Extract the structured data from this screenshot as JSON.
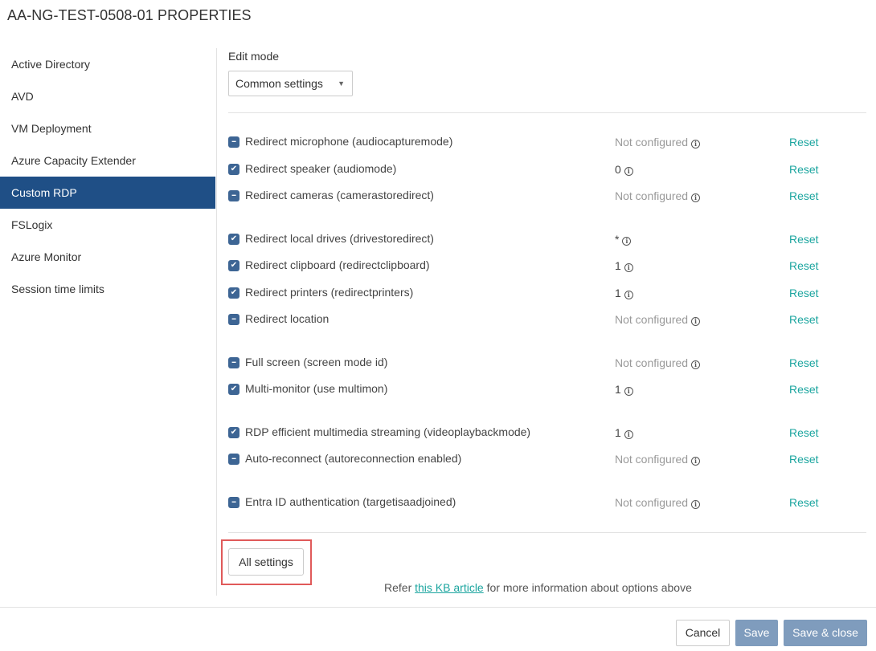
{
  "window": {
    "title": "AA-NG-TEST-0508-01 PROPERTIES"
  },
  "sidebar": {
    "items": [
      {
        "label": "Active Directory",
        "active": false
      },
      {
        "label": "AVD",
        "active": false
      },
      {
        "label": "VM Deployment",
        "active": false
      },
      {
        "label": "Azure Capacity Extender",
        "active": false
      },
      {
        "label": "Custom RDP",
        "active": true
      },
      {
        "label": "FSLogix",
        "active": false
      },
      {
        "label": "Azure Monitor",
        "active": false
      },
      {
        "label": "Session time limits",
        "active": false
      }
    ]
  },
  "edit_mode": {
    "label": "Edit mode",
    "selected": "Common settings"
  },
  "settings": [
    {
      "label": "Redirect microphone (audiocapturemode)",
      "state": "minus",
      "value": "Not configured",
      "reset": "Reset"
    },
    {
      "label": "Redirect speaker (audiomode)",
      "state": "check",
      "value": "0",
      "reset": "Reset"
    },
    {
      "label": "Redirect cameras (camerastoredirect)",
      "state": "minus",
      "value": "Not configured",
      "reset": "Reset"
    },
    {
      "label": "Redirect local drives (drivestoredirect)",
      "state": "check",
      "value": "*",
      "reset": "Reset"
    },
    {
      "label": "Redirect clipboard (redirectclipboard)",
      "state": "check",
      "value": "1",
      "reset": "Reset"
    },
    {
      "label": "Redirect printers (redirectprinters)",
      "state": "check",
      "value": "1",
      "reset": "Reset"
    },
    {
      "label": "Redirect location",
      "state": "minus",
      "value": "Not configured",
      "reset": "Reset"
    },
    {
      "label": "Full screen (screen mode id)",
      "state": "minus",
      "value": "Not configured",
      "reset": "Reset"
    },
    {
      "label": "Multi-monitor (use multimon)",
      "state": "check",
      "value": "1",
      "reset": "Reset"
    },
    {
      "label": "RDP efficient multimedia streaming (videoplaybackmode)",
      "state": "check",
      "value": "1",
      "reset": "Reset"
    },
    {
      "label": "Auto-reconnect (autoreconnection enabled)",
      "state": "minus",
      "value": "Not configured",
      "reset": "Reset"
    },
    {
      "label": "Entra ID authentication (targetisaadjoined)",
      "state": "minus",
      "value": "Not configured",
      "reset": "Reset"
    }
  ],
  "all_settings_label": "All settings",
  "kb": {
    "prefix": "Refer ",
    "link": "this KB article",
    "suffix": " for more information about options above"
  },
  "footer": {
    "cancel": "Cancel",
    "save": "Save",
    "save_close": "Save & close"
  },
  "colors": {
    "sidebar_active": "#1f4f86",
    "link": "#1ba59f",
    "checkbox": "#3d6594",
    "primary_button": "#7f9cbd",
    "highlight": "#e05a5a"
  },
  "icons": {
    "check": "check-icon",
    "minus": "minus-icon",
    "info": "info-icon",
    "caret": "chevron-down-icon"
  }
}
